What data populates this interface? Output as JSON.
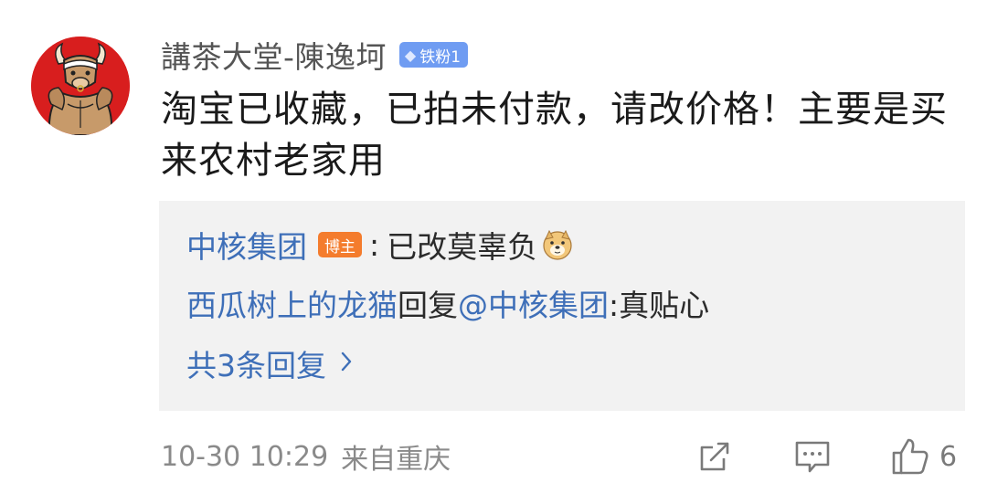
{
  "comment": {
    "username": "講茶大堂-陳逸坷",
    "fan_badge": "铁粉1",
    "text": "淘宝已收藏，已拍未付款，请改价格！主要是买来农村老家用",
    "date": "10-30 10:29",
    "location": "来自重庆",
    "like_count": "6"
  },
  "replies": [
    {
      "author": "中核集团",
      "badge": "博主",
      "separator": ":",
      "text": "已改莫辜负",
      "emoji": "doge-emoji"
    },
    {
      "author": "西瓜树上的龙猫",
      "reply_word": "回复",
      "mention": "@中核集团",
      "text": ":真贴心"
    }
  ],
  "more_replies_label": "共3条回复",
  "colors": {
    "link": "#3e6fb8",
    "fan_badge": "#6f9cf2",
    "author_badge": "#f47c2d",
    "reply_bg": "#f2f2f2",
    "avatar_bg": "#d81e1e"
  },
  "icons": [
    "share-icon",
    "comment-icon",
    "like-icon",
    "chevron-right-icon",
    "diamond-icon"
  ]
}
